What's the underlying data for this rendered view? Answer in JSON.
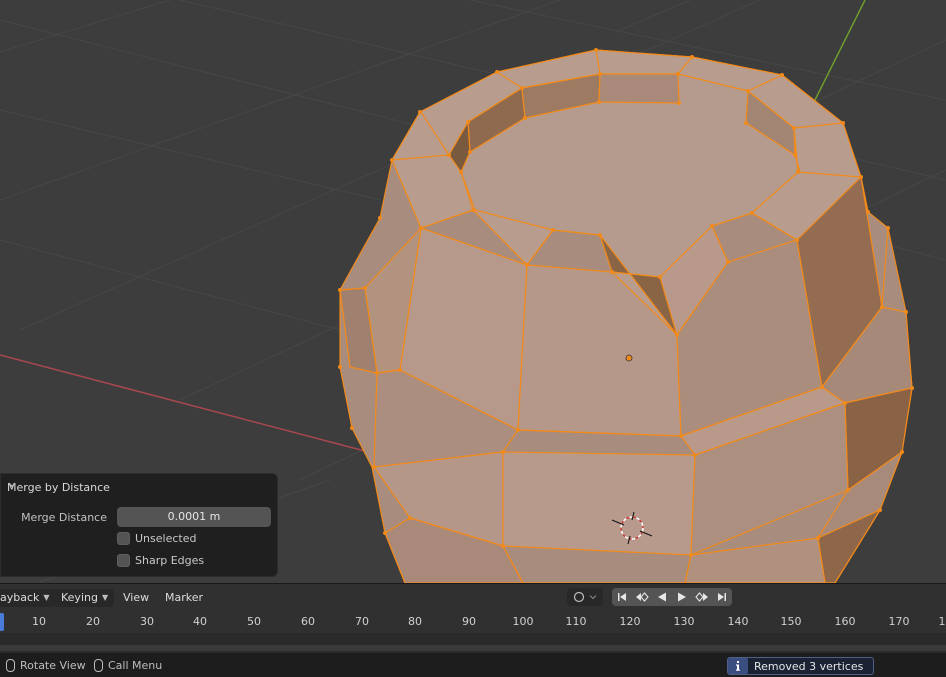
{
  "operator_panel": {
    "title": "Merge by Distance",
    "merge_distance_label": "Merge Distance",
    "merge_distance_value": "0.0001 m",
    "unselected_label": "Unselected",
    "unselected_checked": false,
    "sharp_edges_label": "Sharp Edges",
    "sharp_edges_checked": false
  },
  "timeline": {
    "playback_label": "ayback",
    "keying_label": "Keying",
    "view_label": "View",
    "marker_label": "Marker",
    "frame_numbers": [
      "10",
      "20",
      "30",
      "40",
      "50",
      "60",
      "70",
      "80",
      "90",
      "100",
      "110",
      "120",
      "130",
      "140",
      "150",
      "160",
      "170",
      "1"
    ]
  },
  "statusbar": {
    "rotate_view": "Rotate View",
    "call_menu": "Call Menu",
    "report": "Removed 3 vertices"
  },
  "colors": {
    "selection": "#f28a1a",
    "mesh_face": "#b5998a",
    "x_axis": "#a8474f",
    "y_axis": "#6f9a2e",
    "accent": "#4a7cd9"
  }
}
